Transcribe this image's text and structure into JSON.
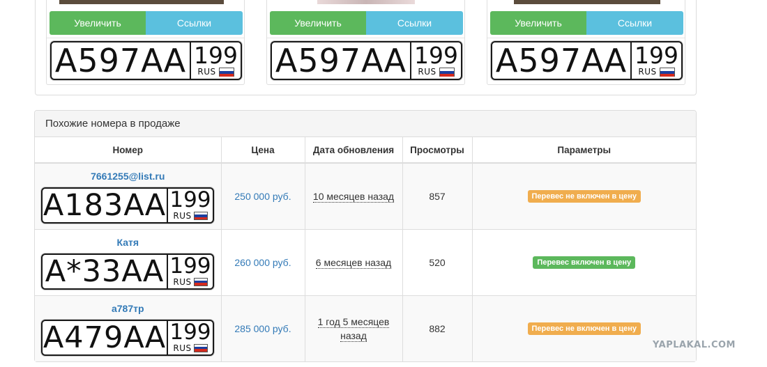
{
  "gallery": {
    "cards": [
      {
        "zoom_label": "Увеличить",
        "links_label": "Ссылки",
        "plate": {
          "letters": "А597АА",
          "region": "199",
          "country": "RUS"
        }
      },
      {
        "zoom_label": "Увеличить",
        "links_label": "Ссылки",
        "plate": {
          "letters": "А597АА",
          "region": "199",
          "country": "RUS"
        }
      },
      {
        "zoom_label": "Увеличить",
        "links_label": "Ссылки",
        "plate": {
          "letters": "А597АА",
          "region": "199",
          "country": "RUS"
        }
      }
    ]
  },
  "similar": {
    "title": "Похожие номера в продаже",
    "columns": [
      "Номер",
      "Цена",
      "Дата обновления",
      "Просмотры",
      "Параметры"
    ],
    "rows": [
      {
        "seller": "7661255@list.ru",
        "plate": {
          "letters": "А183АА",
          "region": "199",
          "country": "RUS"
        },
        "price": "250 000 руб.",
        "date_line1": "10 месяцев назад",
        "date_line2": "",
        "views": "857",
        "param": "Перевес не включен в цену",
        "param_color": "#f0ad4e"
      },
      {
        "seller": "Катя",
        "plate": {
          "letters": "А*33АА",
          "region": "199",
          "country": "RUS"
        },
        "price": "260 000 руб.",
        "date_line1": "6 месяцев назад",
        "date_line2": "",
        "views": "520",
        "param": "Перевес включен в цену",
        "param_color": "#5cb85c"
      },
      {
        "seller": "а787тр",
        "plate": {
          "letters": "А479АА",
          "region": "199",
          "country": "RUS"
        },
        "price": "285 000 руб.",
        "date_line1": "1 год 5 месяцев",
        "date_line2": "назад",
        "views": "882",
        "param": "Перевес не включен в цену",
        "param_color": "#f0ad4e"
      }
    ]
  },
  "watermark": "YAPLAKAL.COM",
  "colors": {
    "green": "#5cb85c",
    "blue": "#5bc0de",
    "link": "#337ab7",
    "warning": "#f0ad4e",
    "flag": [
      "#ffffff",
      "#1c3fa0",
      "#d52b1e"
    ]
  }
}
